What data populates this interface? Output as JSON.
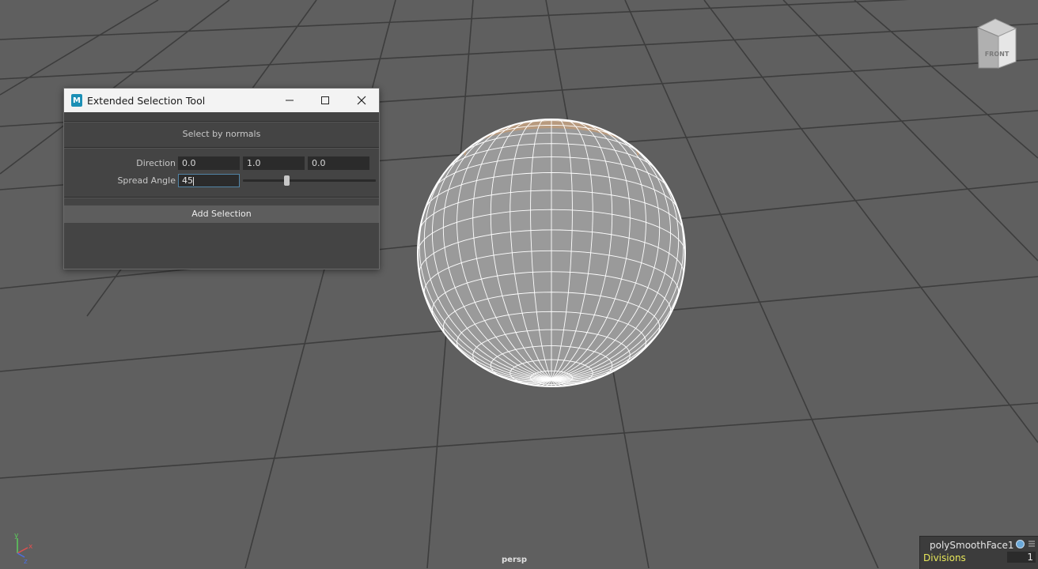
{
  "viewport": {
    "camera_label": "persp",
    "viewcube_label": "FRONT",
    "axis_labels": {
      "y": "y",
      "x": "x",
      "z": "z"
    }
  },
  "dialog": {
    "app_icon": "maya-icon",
    "title": "Extended Selection Tool",
    "section_title": "Select by normals",
    "direction_label": "Direction",
    "direction_values": [
      "0.0",
      "1.0",
      "0.0"
    ],
    "spread_label": "Spread Angle",
    "spread_value": "45",
    "spread_slider_fraction": 0.33,
    "add_button_label": "Add Selection",
    "window_buttons": [
      "minimize-icon",
      "maximize-icon",
      "close-icon"
    ]
  },
  "channel_box": {
    "node_name": "polySmoothFace1",
    "attr_name": "Divisions",
    "attr_value": "1",
    "attr_color": "#e8e85a"
  },
  "colors": {
    "viewport_bg": "#5f5f5f",
    "grid": "#3a3a3a",
    "selection_tint": "#b89a7e",
    "wire": "#ffffff"
  }
}
